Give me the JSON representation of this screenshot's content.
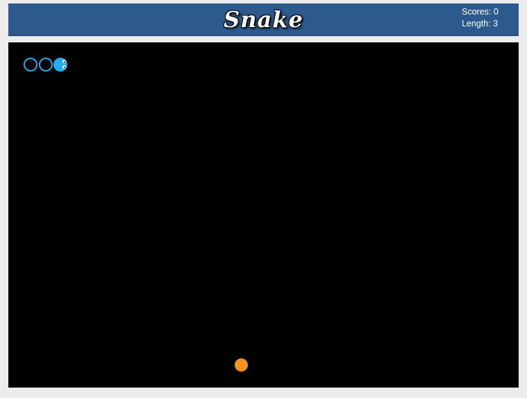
{
  "header": {
    "title": "Snake",
    "scores_text": "Scores: 0",
    "length_text": "Length: 3"
  },
  "game": {
    "score": 0,
    "length": 3,
    "colors": {
      "snake": "#1eaeee",
      "food": "#f7921e",
      "board": "#000000",
      "header": "#2c5a8c"
    }
  }
}
